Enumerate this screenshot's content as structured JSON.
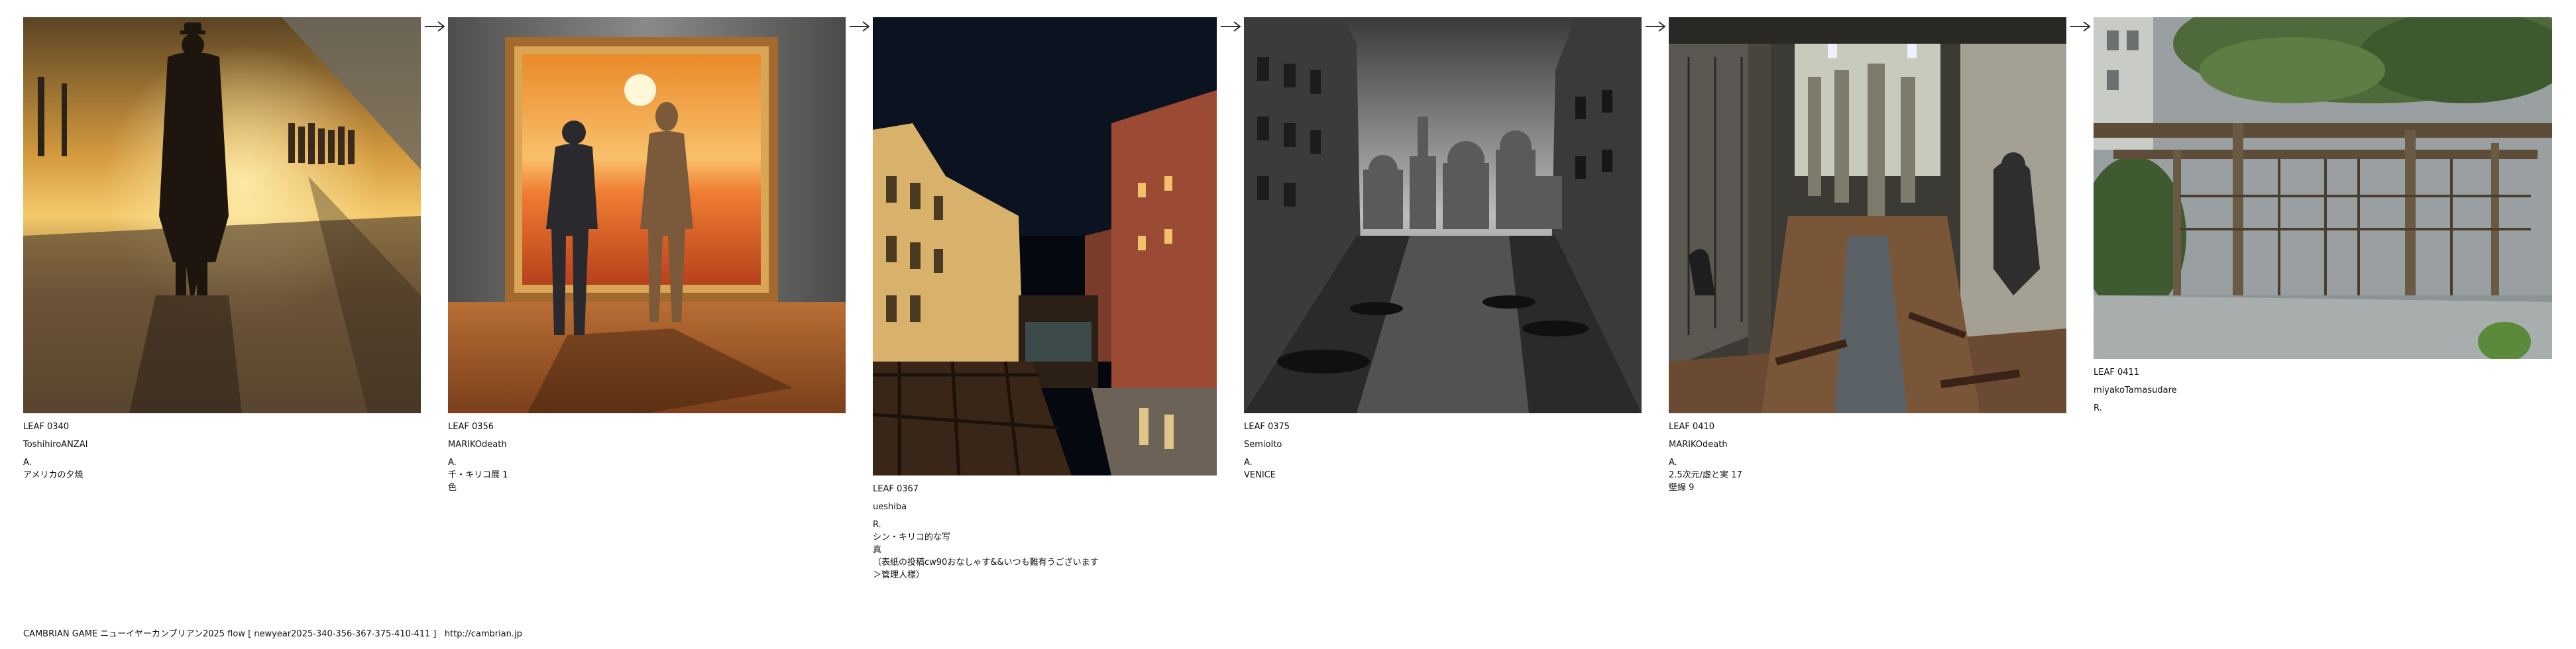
{
  "leaves": [
    {
      "code": "LEAF 0340",
      "author": "ToshihiroANZAI",
      "mark": "A.",
      "lines": [
        "アメリカの夕焼"
      ]
    },
    {
      "code": "LEAF 0356",
      "author": "MARIKOdeath",
      "mark": "A.",
      "lines": [
        "千・キリコ展 1",
        "色"
      ]
    },
    {
      "code": "LEAF 0367",
      "author": "ueshiba",
      "mark": "R.",
      "lines": [
        "シン・キリコ的な写",
        "真",
        "（表紙の投稿cw90おなしゃす&&いつも難有うございます",
        "＞管理人様）"
      ]
    },
    {
      "code": "LEAF 0375",
      "author": "SemioIto",
      "mark": "A.",
      "lines": [
        "VENICE"
      ]
    },
    {
      "code": "LEAF 0410",
      "author": "MARIKOdeath",
      "mark": "A.",
      "lines": [
        "2.5次元/虚と実 17",
        "壁線 9"
      ]
    },
    {
      "code": "LEAF 0411",
      "author": "miyakoTamasudare",
      "mark": "R.",
      "lines": []
    }
  ],
  "footer": {
    "text": "CAMBRIAN GAME ニューイヤーカンブリアン2025 flow [ newyear2025-340-356-367-375-410-411 ]",
    "url": "http://cambrian.jp"
  },
  "icons": [
    "arrow-right-icon"
  ]
}
